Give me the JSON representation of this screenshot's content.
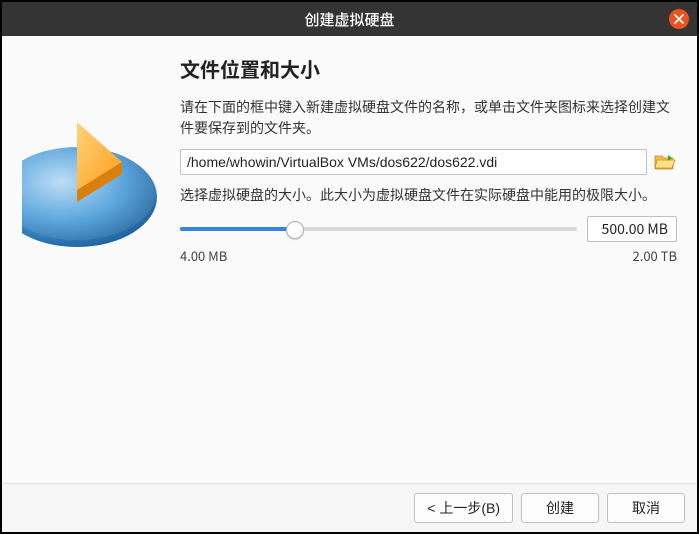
{
  "window": {
    "title": "创建虚拟硬盘"
  },
  "heading": "文件位置和大小",
  "desc1": "请在下面的框中键入新建虚拟硬盘文件的名称，或单击文件夹图标来选择创建文件要保存到的文件夹。",
  "file_path": "/home/whowin/VirtualBox VMs/dos622/dos622.vdi",
  "desc2": "选择虚拟硬盘的大小。此大小为虚拟硬盘文件在实际硬盘中能用的极限大小。",
  "slider": {
    "min_label": "4.00 MB",
    "max_label": "2.00 TB",
    "value_label": "500.00 MB",
    "fill_percent": 29
  },
  "buttons": {
    "back": "< 上一步(B)",
    "create": "创建",
    "cancel": "取消"
  }
}
